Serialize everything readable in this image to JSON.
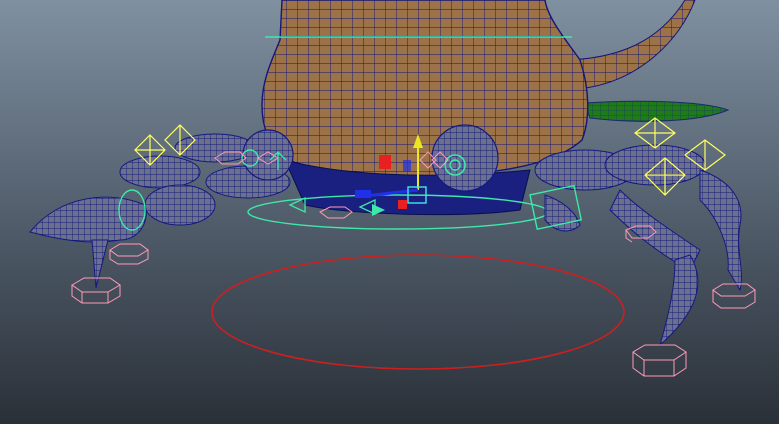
{
  "viewport": {
    "background_top": "#7f90a0",
    "background_bottom": "#2a3038"
  },
  "scene": {
    "mesh_fill_color": "#9c7248",
    "wireframe_color": "#101a8a",
    "leg_fill_color": "#6a6e88",
    "leaf_color": "#1f7a1a",
    "control_curve_color": "#3ee8a8",
    "ik_handle_color": "#ffff60",
    "locator_color": "#ff9ab8",
    "ground_circle_color": "#cc2020",
    "manipulator_y_color": "#e8e820",
    "manipulator_x_color": "#e82020",
    "manipulator_z_color": "#2030e8"
  }
}
